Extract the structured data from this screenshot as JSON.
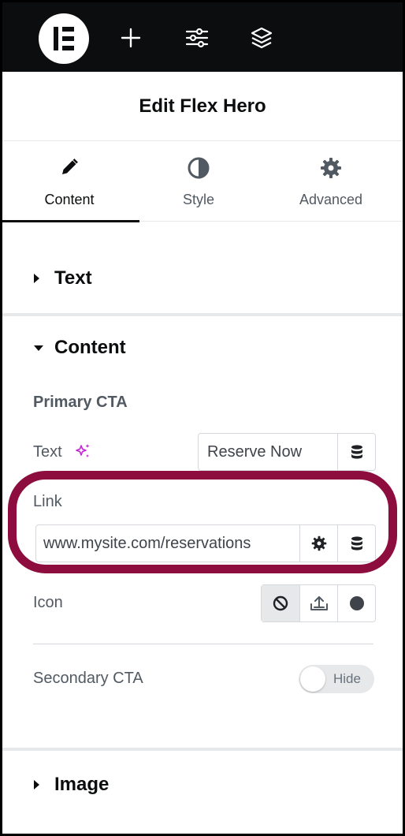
{
  "title": "Edit Flex Hero",
  "tabs": [
    {
      "label": "Content",
      "icon": "pencil-icon",
      "active": true
    },
    {
      "label": "Style",
      "icon": "half-circle-icon",
      "active": false
    },
    {
      "label": "Advanced",
      "icon": "gear-icon",
      "active": false
    }
  ],
  "sections": {
    "text": "Text",
    "content": "Content",
    "image": "Image"
  },
  "content": {
    "group_heading": "Primary CTA",
    "text_label": "Text",
    "text_value": "Reserve Now",
    "link_label": "Link",
    "link_value": "www.mysite.com/reservations",
    "icon_label": "Icon",
    "secondary_label": "Secondary CTA",
    "secondary_toggle": "Hide"
  },
  "colors": {
    "highlight": "#8c0d3e",
    "ai_sparkle": "#c026d3",
    "topbar": "#0c0d0e"
  }
}
